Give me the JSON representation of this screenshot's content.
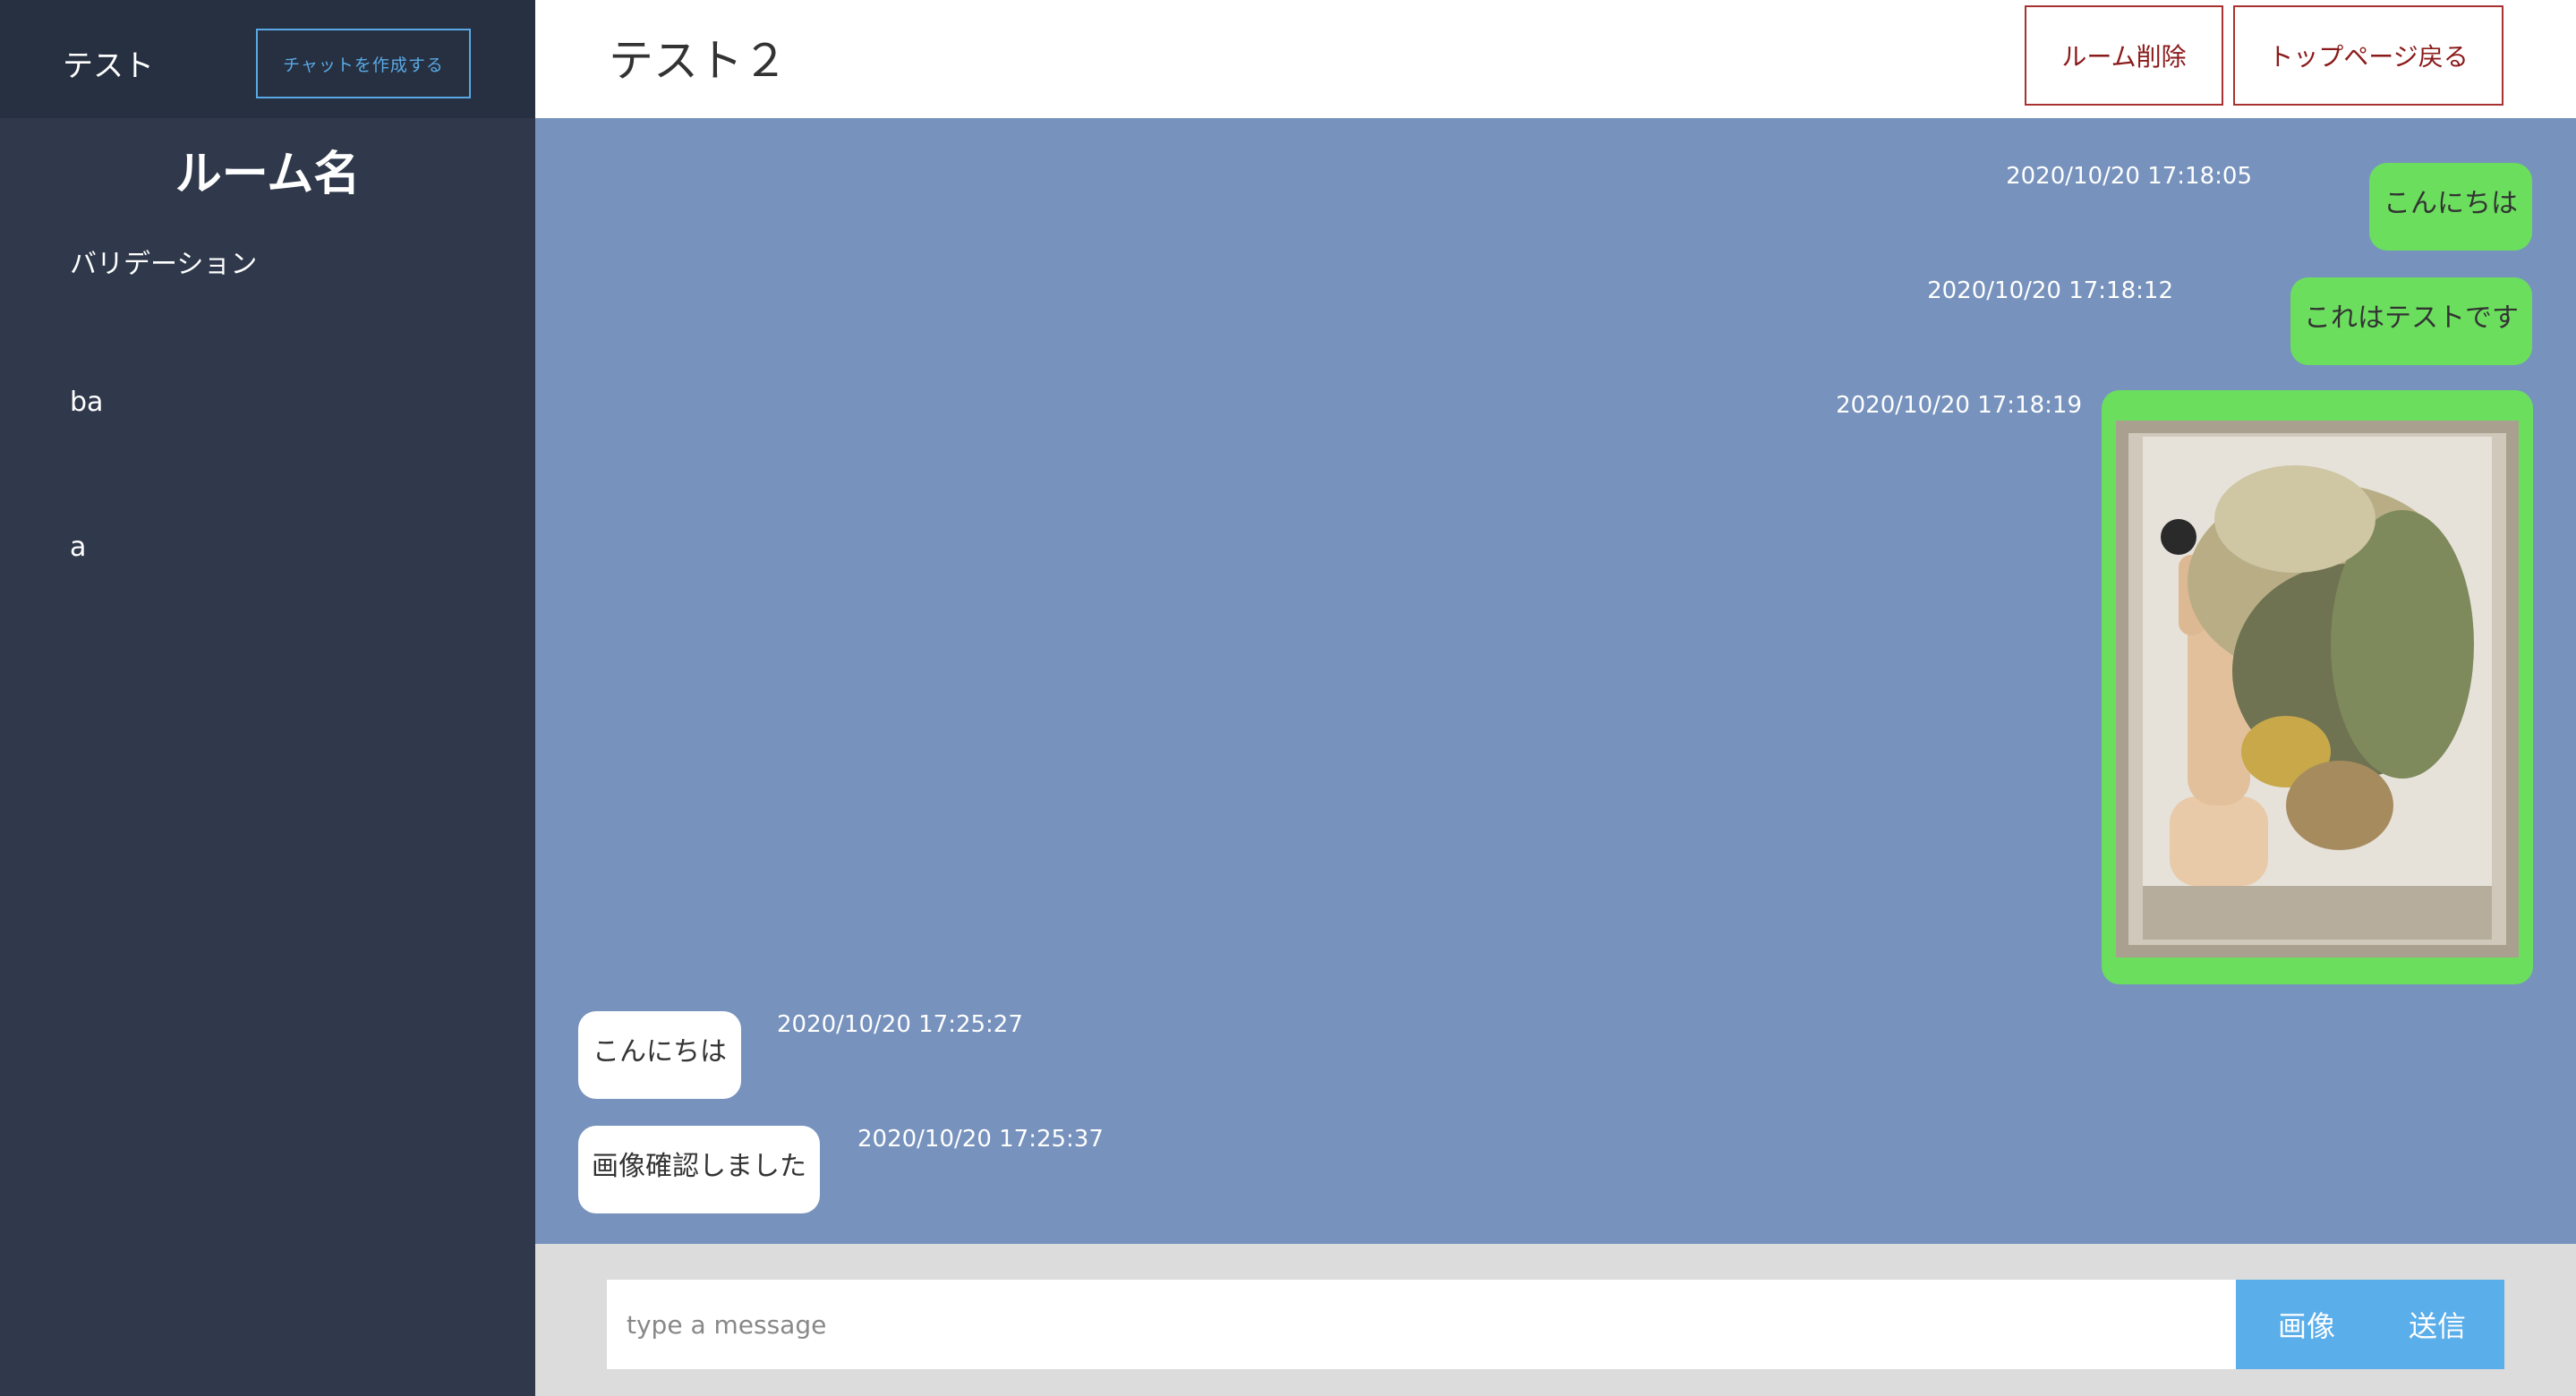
{
  "sidebar": {
    "user_name": "テスト",
    "create_chat_label": "チャットを作成する",
    "heading": "ルーム名",
    "rooms": [
      {
        "label": "バリデーション"
      },
      {
        "label": "ba"
      },
      {
        "label": "a"
      }
    ]
  },
  "header": {
    "room_title": "テスト２",
    "delete_room_label": "ルーム削除",
    "back_to_top_label": "トップページ戻る"
  },
  "messages": [
    {
      "side": "me",
      "type": "text",
      "text": "こんにちは",
      "timestamp": "2020/10/20 17:18:05"
    },
    {
      "side": "me",
      "type": "text",
      "text": "これはテストです",
      "timestamp": "2020/10/20 17:18:12"
    },
    {
      "side": "me",
      "type": "image",
      "timestamp": "2020/10/20 17:18:19"
    },
    {
      "side": "other",
      "type": "text",
      "text": "こんにちは",
      "timestamp": "2020/10/20 17:25:27"
    },
    {
      "side": "other",
      "type": "text",
      "text": "画像確認しました",
      "timestamp": "2020/10/20 17:25:37"
    }
  ],
  "composer": {
    "placeholder": "type a message",
    "value": "",
    "image_label": "画像",
    "send_label": "送信"
  },
  "colors": {
    "sidebar_bg": "#2f394b",
    "chat_bg": "#7792bd",
    "my_bubble": "#6bde5e",
    "other_bubble": "#ffffff",
    "accent": "#5aaeea",
    "danger": "#a83232"
  }
}
